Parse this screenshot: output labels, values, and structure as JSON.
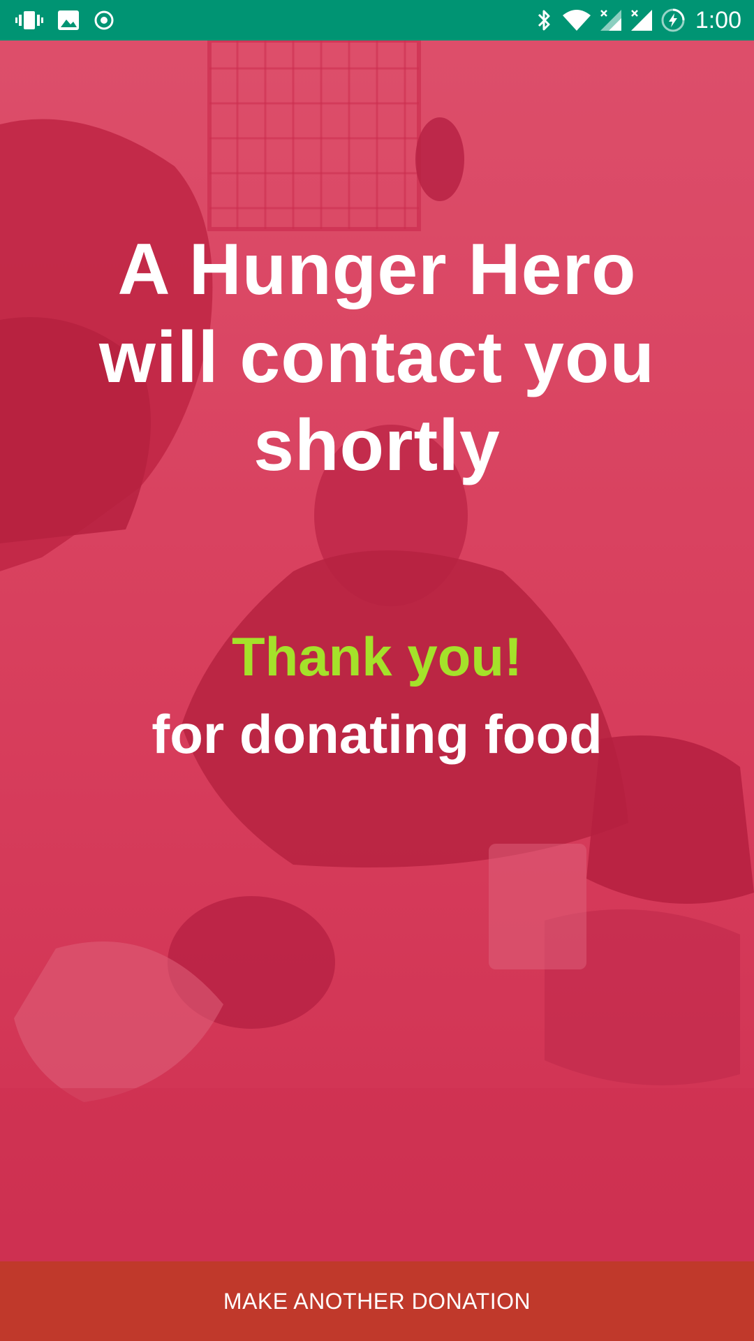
{
  "status_bar": {
    "left_icons": [
      "vibrate-icon",
      "image-icon",
      "record-icon"
    ],
    "right_icons": [
      "bluetooth-icon",
      "wifi-icon",
      "signal-x-icon",
      "signal-x-icon",
      "battery-charging-icon"
    ],
    "time": "1:00",
    "color": "#009473"
  },
  "main": {
    "headline": "A Hunger Hero will contact you shortly",
    "thanks": "Thank you!",
    "subtext": "for donating food",
    "overlay_color": "#d63a5a",
    "thanks_color": "#a4e22a"
  },
  "footer": {
    "button_label": "MAKE ANOTHER DONATION",
    "button_color": "#c0392b"
  }
}
